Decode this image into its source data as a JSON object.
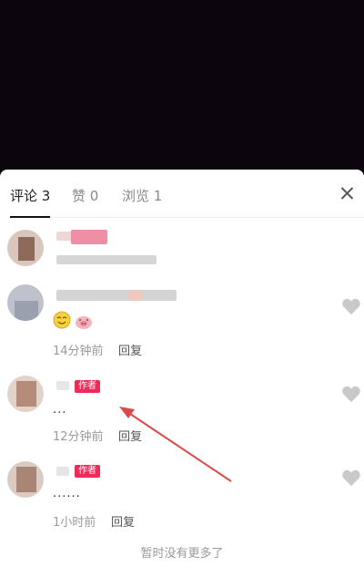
{
  "tabs": [
    {
      "label": "评论 3"
    },
    {
      "label": "赞 0"
    },
    {
      "label": "浏览 1"
    }
  ],
  "comments": [
    {
      "time": "",
      "reply": ""
    },
    {
      "time": "14分钟前",
      "reply": "回复"
    },
    {
      "badge": "作者",
      "text": "...",
      "time": "12分钟前",
      "reply": "回复"
    },
    {
      "badge": "作者",
      "text": "......",
      "time": "1小时前",
      "reply": "回复"
    }
  ],
  "footer": "暂时没有更多了",
  "colors": {
    "accent": "#f02b5b",
    "arrow": "#d94b4b"
  },
  "icons": {
    "close": "close-icon",
    "like": "heart-icon"
  }
}
